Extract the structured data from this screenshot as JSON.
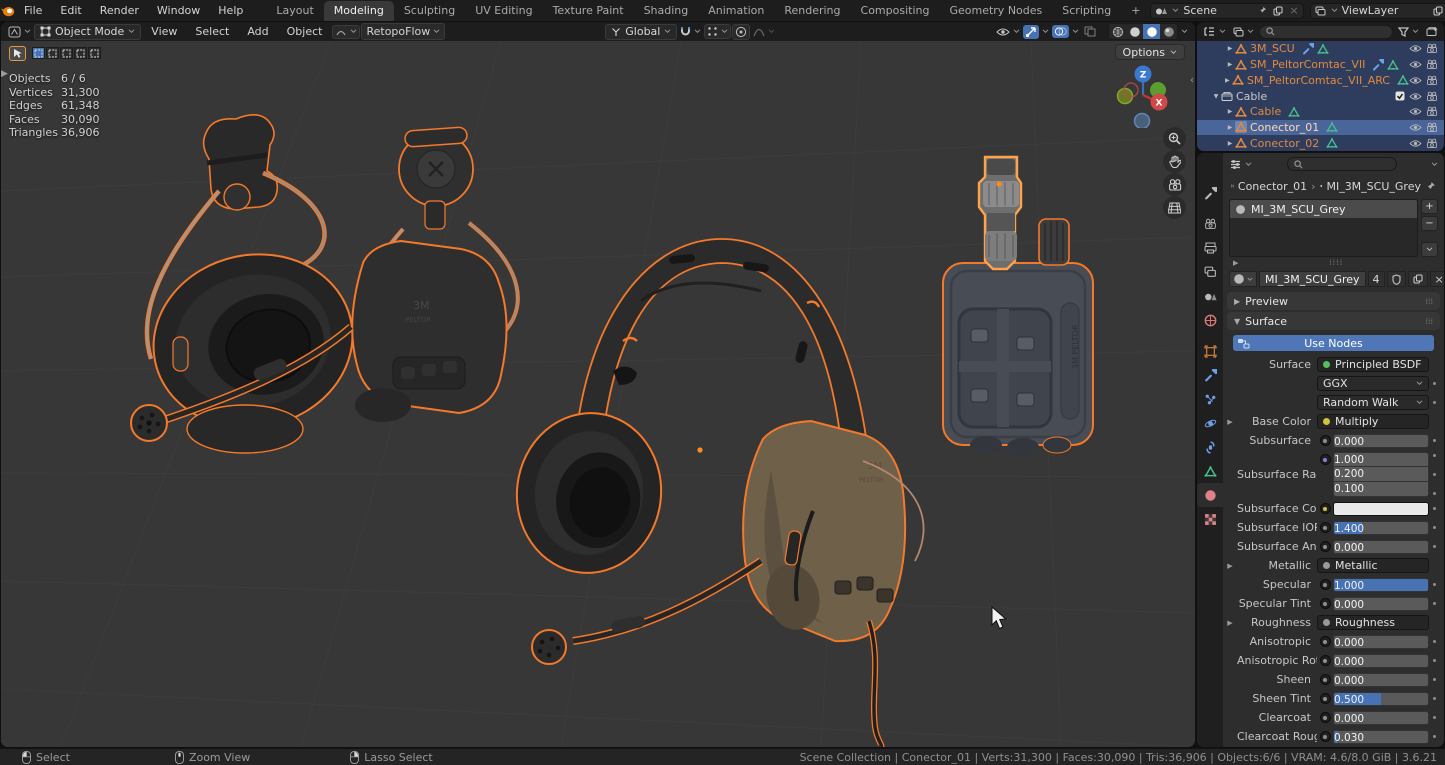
{
  "topbar": {
    "menus": [
      "File",
      "Edit",
      "Render",
      "Window",
      "Help"
    ],
    "workspaces": [
      "Layout",
      "Modeling",
      "Sculpting",
      "UV Editing",
      "Texture Paint",
      "Shading",
      "Animation",
      "Rendering",
      "Compositing",
      "Geometry Nodes",
      "Scripting",
      "+"
    ],
    "active_workspace": "Modeling",
    "scene_label": "Scene",
    "view_layer_label": "ViewLayer"
  },
  "viewport_header": {
    "mode": "Object Mode",
    "menus": [
      "View",
      "Select",
      "Add",
      "Object"
    ],
    "addon_menu": "RetopoFlow",
    "orientation": "Global"
  },
  "viewport": {
    "options_button": "Options",
    "axis_z": "Z",
    "axis_x": "X",
    "select_modes": [
      "set",
      "extend",
      "subtract",
      "invert",
      "intersect"
    ],
    "model_labels": [
      "3M",
      "PELTOR"
    ],
    "stats": [
      {
        "label": "Objects",
        "value": "6 / 6"
      },
      {
        "label": "Vertices",
        "value": "31,300"
      },
      {
        "label": "Edges",
        "value": "61,348"
      },
      {
        "label": "Faces",
        "value": "30,090"
      },
      {
        "label": "Triangles",
        "value": "36,906"
      }
    ]
  },
  "outliner": {
    "search_placeholder": "",
    "items": [
      {
        "label": "3M_SCU",
        "type": "mesh-object",
        "indent": 2,
        "extras": [
          "modifier-wrench",
          "mesh-data"
        ],
        "selected": true,
        "active": false,
        "checkbox": false
      },
      {
        "label": "SM_PeltorComtac_VII",
        "type": "mesh-object",
        "indent": 2,
        "extras": [
          "modifier-wrench",
          "mesh-data"
        ],
        "selected": true,
        "active": false,
        "checkbox": false
      },
      {
        "label": "SM_PeltorComtac_VII_ARC",
        "type": "mesh-object",
        "indent": 2,
        "extras": [
          "mesh-data"
        ],
        "selected": true,
        "active": false,
        "checkbox": false
      },
      {
        "label": "Cable",
        "type": "collection",
        "indent": 1,
        "extras": [],
        "selected": true,
        "active": false,
        "checkbox": true
      },
      {
        "label": "Cable",
        "type": "mesh-object",
        "indent": 2,
        "extras": [
          "mesh-data"
        ],
        "selected": true,
        "active": false,
        "checkbox": false
      },
      {
        "label": "Conector_01",
        "type": "mesh-object",
        "indent": 2,
        "extras": [
          "mesh-data"
        ],
        "selected": true,
        "active": true,
        "checkbox": false
      },
      {
        "label": "Conector_02",
        "type": "mesh-object",
        "indent": 2,
        "extras": [
          "mesh-data"
        ],
        "selected": true,
        "active": false,
        "checkbox": false
      }
    ]
  },
  "properties": {
    "search_placeholder": "",
    "tabs": [
      "tool",
      "render",
      "output",
      "view-layer",
      "scene",
      "world",
      "object",
      "modifiers",
      "particles",
      "physics",
      "constraints",
      "object-data",
      "material",
      "texture"
    ],
    "active_tab": "material",
    "breadcrumb_object": "Conector_01",
    "breadcrumb_material": "MI_3M_SCU_Grey",
    "slot_name": "MI_3M_SCU_Grey",
    "datablock_name": "MI_3M_SCU_Grey",
    "users_count": "4",
    "preview_panel": "Preview",
    "surface_panel": "Surface",
    "use_nodes_label": "Use Nodes",
    "rows": [
      {
        "type": "node",
        "label": "Surface",
        "value": "Principled BSDF",
        "dot": "#56c05c",
        "expand": false,
        "decorator": false
      },
      {
        "type": "dropdown",
        "label": "",
        "value": "GGX",
        "decorator": true
      },
      {
        "type": "dropdown",
        "label": "",
        "value": "Random Walk",
        "decorator": true
      },
      {
        "type": "node",
        "label": "Base Color",
        "value": "Multiply",
        "dot": "#d2c23d",
        "expand": true,
        "decorator": false
      },
      {
        "type": "slider",
        "label": "Subsurface",
        "value": "0.000",
        "fill": 0,
        "decorator": true
      },
      {
        "type": "multi",
        "label": "Subsurface Radius",
        "values": [
          "1.000",
          "0.200",
          "0.100"
        ],
        "socket": "#8879e0",
        "decorator": true
      },
      {
        "type": "color",
        "label": "Subsurface Color",
        "socket": "#d2c23d",
        "swatch": "#e9e9e9",
        "decorator": true
      },
      {
        "type": "slider",
        "label": "Subsurface IOR",
        "value": "1.400",
        "fill": 0.3,
        "decorator": true
      },
      {
        "type": "slider",
        "label": "Subsurface Aniso...",
        "value": "0.000",
        "fill": 0,
        "decorator": true
      },
      {
        "type": "node",
        "label": "Metallic",
        "value": "Metallic",
        "dot": "#9a9a9a",
        "expand": true,
        "decorator": false
      },
      {
        "type": "slider",
        "label": "Specular",
        "value": "1.000",
        "fill": 1,
        "decorator": true
      },
      {
        "type": "slider",
        "label": "Specular Tint",
        "value": "0.000",
        "fill": 0,
        "decorator": true
      },
      {
        "type": "node",
        "label": "Roughness",
        "value": "Roughness",
        "dot": "#9a9a9a",
        "expand": true,
        "decorator": false
      },
      {
        "type": "slider",
        "label": "Anisotropic",
        "value": "0.000",
        "fill": 0,
        "decorator": true
      },
      {
        "type": "slider",
        "label": "Anisotropic Rota...",
        "value": "0.000",
        "fill": 0,
        "decorator": true
      },
      {
        "type": "slider",
        "label": "Sheen",
        "value": "0.000",
        "fill": 0,
        "decorator": true
      },
      {
        "type": "slider",
        "label": "Sheen Tint",
        "value": "0.500",
        "fill": 0.5,
        "decorator": true
      },
      {
        "type": "slider",
        "label": "Clearcoat",
        "value": "0.000",
        "fill": 0,
        "decorator": true
      },
      {
        "type": "slider",
        "label": "Clearcoat Rough...",
        "value": "0.030",
        "fill": 0.03,
        "decorator": true
      }
    ]
  },
  "statusbar": {
    "hints": [
      {
        "icon": "mouse-left",
        "label": "Select"
      },
      {
        "icon": "mouse-middle",
        "label": "Zoom View"
      },
      {
        "icon": "mouse-right",
        "label": "Lasso Select"
      }
    ],
    "info": "Scene Collection | Conector_01 | Verts:31,300 | Faces:30,090 | Tris:36,906 | Objects:6/6 | VRAM: 4.6/8.0 GiB | 3.6.21"
  },
  "colors": {
    "accent_blue": "#4772b3",
    "selection_outline": "#f4792b",
    "active_outline": "#ffa24a",
    "viewport_bg": "#373737"
  }
}
